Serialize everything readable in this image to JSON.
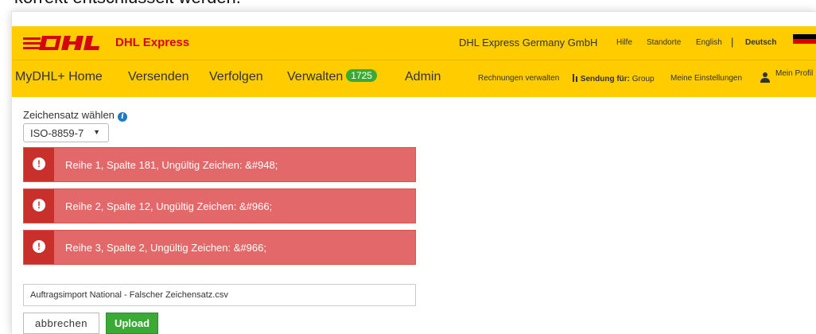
{
  "caption": "korrekt entschlüsselt werden.",
  "header": {
    "brand": "DHL Express",
    "company": "DHL Express Germany GmbH",
    "links": [
      "Hilfe",
      "Standorte",
      "English"
    ],
    "separator": "|",
    "active_language": "Deutsch"
  },
  "nav": {
    "home": "MyDHL+ Home",
    "ship": "Versenden",
    "track": "Verfolgen",
    "manage": "Verwalten",
    "manage_count": "1725",
    "admin": "Admin",
    "invoices": "Rechnungen verwalten",
    "shipment_for_label": "Sendung für:",
    "shipment_for_value": "Group",
    "settings": "Meine Einstellungen",
    "profile": "Mein Profil"
  },
  "form": {
    "charset_label": "Zeichensatz wählen",
    "charset_value": "ISO-8859-7",
    "errors": [
      "Reihe 1, Spalte 181, Ungültig Zeichen: &#948;",
      "Reihe 2, Spalte 12, Ungültig Zeichen: &#966;",
      "Reihe 3, Spalte 2, Ungültig Zeichen: &#966;"
    ],
    "file_name": "Auftragsimport National - Falscher Zeichensatz.csv",
    "cancel_label": "abbrechen",
    "upload_label": "Upload"
  },
  "colors": {
    "brand_yellow": "#ffcc00",
    "brand_red": "#d40511",
    "error_red": "#e26869",
    "success_green": "#3aa935"
  }
}
